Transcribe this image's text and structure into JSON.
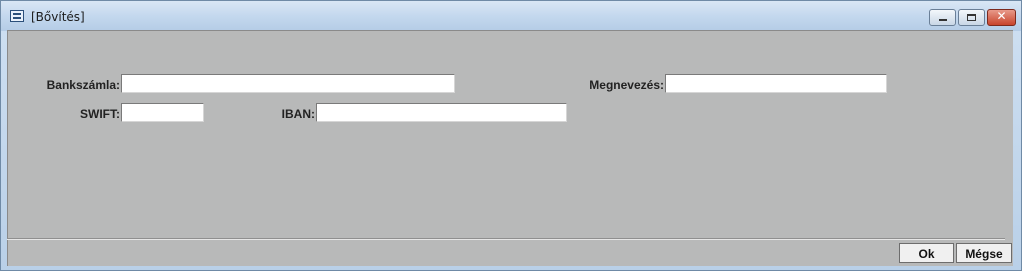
{
  "window": {
    "title": "[Bővítés]"
  },
  "fields": {
    "bankszamla": {
      "label": "Bankszámla:",
      "value": ""
    },
    "megnevezes": {
      "label": "Megnevezés:",
      "value": ""
    },
    "swift": {
      "label": "SWIFT:",
      "value": ""
    },
    "iban": {
      "label": "IBAN:",
      "value": ""
    }
  },
  "buttons": {
    "ok": "Ok",
    "cancel": "Mégse"
  },
  "icons": {
    "window": "form-icon",
    "minimize": "minimize-icon",
    "maximize": "maximize-icon",
    "close": "close-icon"
  },
  "colors": {
    "client_bg": "#b8b9b9",
    "title_bg": "#c4d8ee",
    "close_btn": "#c8442c"
  }
}
